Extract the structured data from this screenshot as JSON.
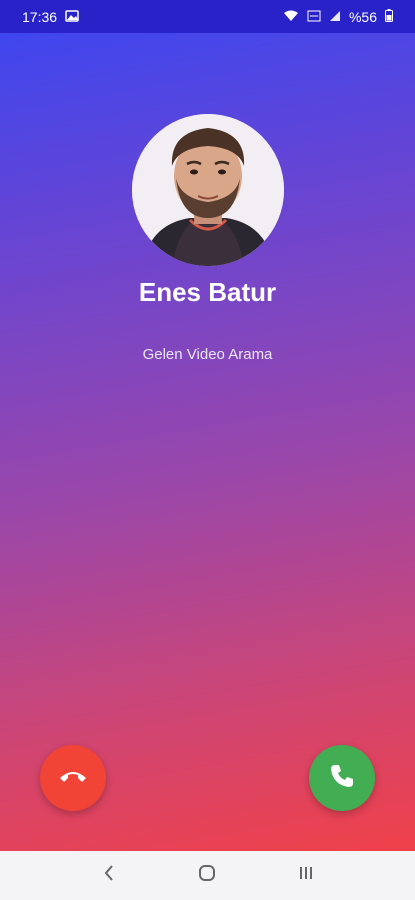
{
  "status_bar": {
    "time": "17:36",
    "battery": "%56",
    "icons": [
      "image-icon",
      "wifi-icon",
      "volte-icon",
      "signal-icon",
      "battery-icon"
    ]
  },
  "call": {
    "caller_name": "Enes Batur",
    "status_text": "Gelen Video Arama"
  },
  "actions": {
    "decline_icon": "phone-hangup-icon",
    "accept_icon": "phone-icon"
  },
  "nav": {
    "icons": [
      "back-icon",
      "home-icon",
      "recents-icon"
    ]
  },
  "colors": {
    "status_bar": "#2a22c9",
    "gradient_top": "#3f46ee",
    "gradient_bottom": "#f0414a",
    "decline": "#f14336",
    "accept": "#43ad53"
  }
}
